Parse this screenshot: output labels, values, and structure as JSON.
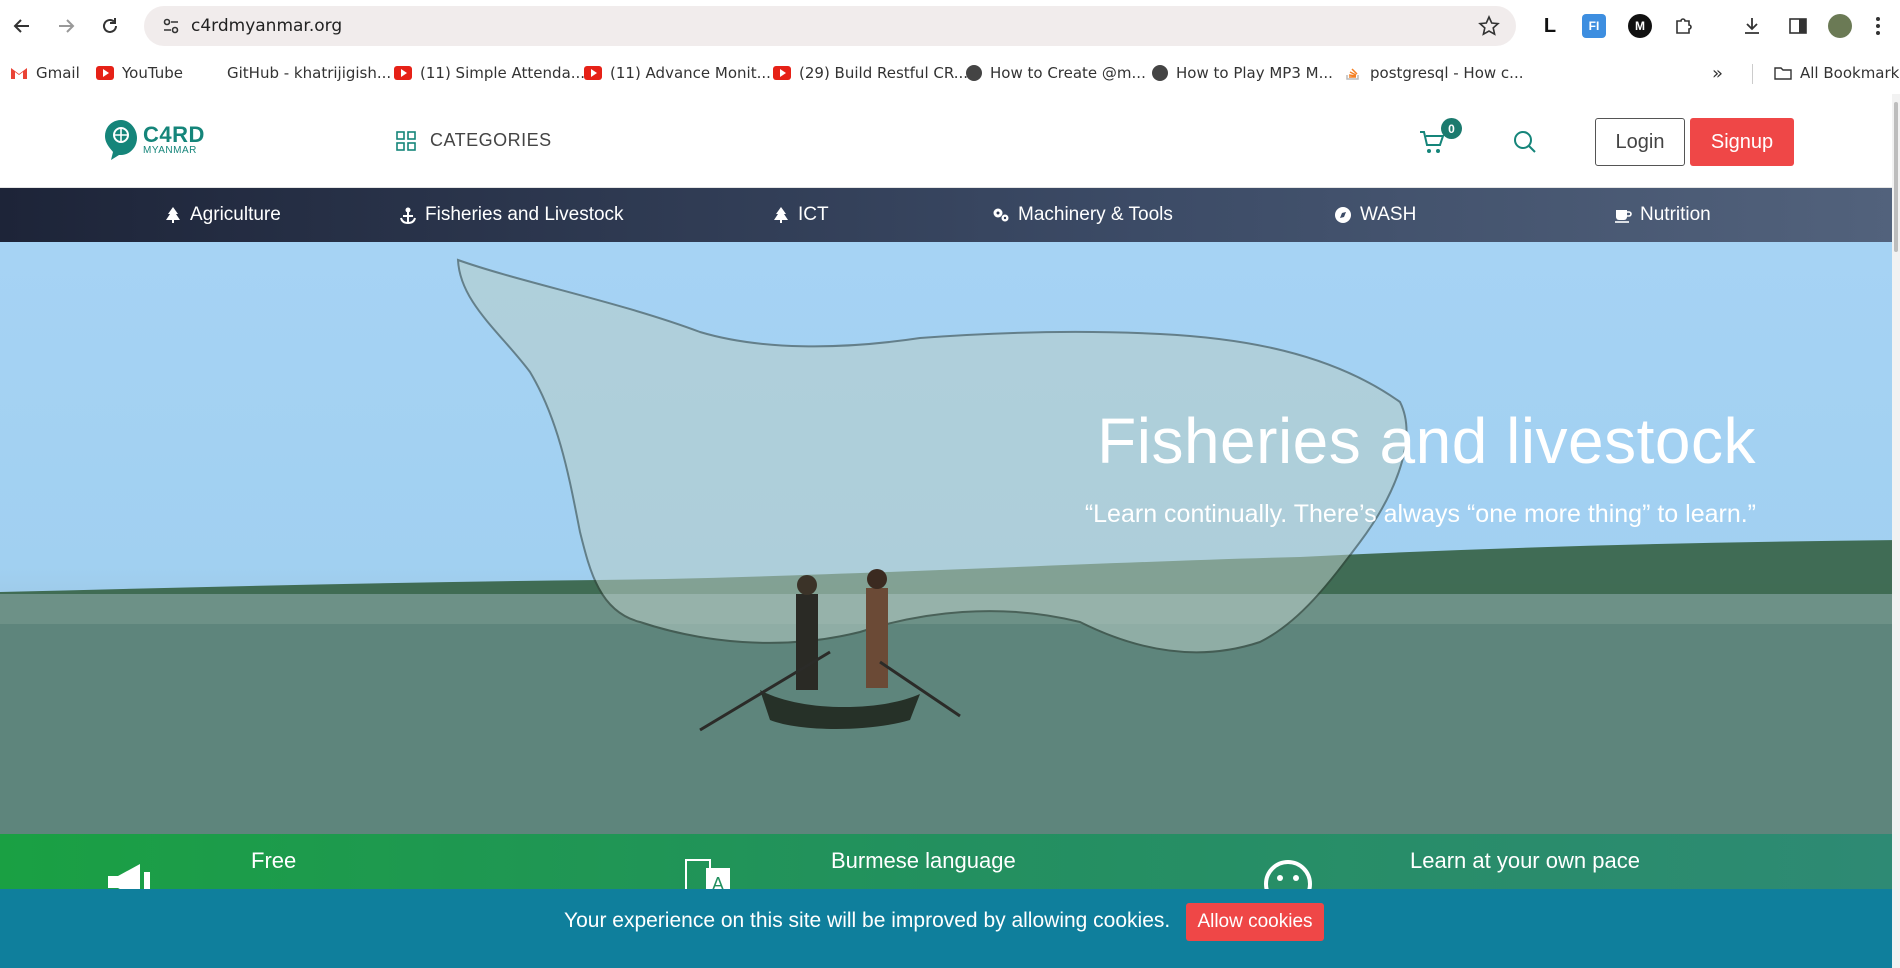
{
  "browser": {
    "url": "c4rdmyanmar.org",
    "bookmarks": [
      {
        "label": "Gmail",
        "icon": "gmail-icon"
      },
      {
        "label": "YouTube",
        "icon": "youtube-icon"
      },
      {
        "label": "GitHub - khatrijigish...",
        "icon": "github-icon"
      },
      {
        "label": "(11) Simple Attenda...",
        "icon": "youtube-icon"
      },
      {
        "label": "(11) Advance Monit...",
        "icon": "youtube-icon"
      },
      {
        "label": "(29) Build Restful CR...",
        "icon": "youtube-icon"
      },
      {
        "label": "How to Create @m...",
        "icon": "globe-icon"
      },
      {
        "label": "How to Play MP3 M...",
        "icon": "globe-icon"
      },
      {
        "label": "postgresql - How c...",
        "icon": "stackoverflow-icon"
      }
    ],
    "all_bookmarks": "All Bookmarks",
    "more_bookmarks": "»"
  },
  "header": {
    "logo_line1": "C4RD",
    "logo_line2": "MYANMAR",
    "categories_label": "CATEGORIES",
    "cart_count": "0",
    "login_label": "Login",
    "signup_label": "Signup"
  },
  "category_nav": [
    {
      "label": "Agriculture",
      "icon": "tree-icon"
    },
    {
      "label": "Fisheries and Livestock",
      "icon": "anchor-icon"
    },
    {
      "label": "ICT",
      "icon": "tree-icon"
    },
    {
      "label": "Machinery & Tools",
      "icon": "cogs-icon"
    },
    {
      "label": "WASH",
      "icon": "compass-icon"
    },
    {
      "label": "Nutrition",
      "icon": "cup-icon"
    }
  ],
  "hero": {
    "title": "Fisheries and livestock",
    "quote": "“Learn continually. There’s always “one more thing” to learn.”"
  },
  "features": [
    {
      "title": "Free",
      "icon": "megaphone-icon"
    },
    {
      "title": "Burmese language",
      "icon": "language-icon"
    },
    {
      "title": "Learn at your own pace",
      "icon": "smiley-icon"
    }
  ],
  "cookie": {
    "text": "Your experience on this site will be improved by allowing cookies.",
    "button": "Allow cookies"
  },
  "colors": {
    "brand_teal": "#15857a",
    "signup_red": "#ef4747",
    "cookie_bar": "#0f7f9c",
    "nav_dark": "#1d2438",
    "feature_green": "#1aa043"
  }
}
